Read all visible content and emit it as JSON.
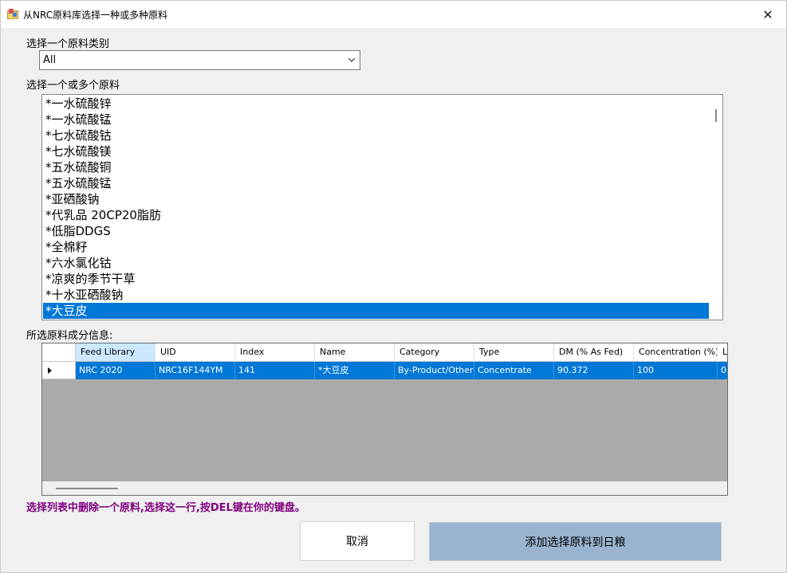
{
  "window": {
    "title": "从NRC原料库选择一种或多种原料",
    "close_glyph": "✕"
  },
  "category": {
    "label": "选择一个原料类别",
    "selected": "All"
  },
  "ingredients": {
    "label": "选择一个或多个原料",
    "items": [
      {
        "label": "*一水硫酸锌",
        "selected": false
      },
      {
        "label": "*一水硫酸锰",
        "selected": false
      },
      {
        "label": "*七水硫酸钴",
        "selected": false
      },
      {
        "label": "*七水硫酸镁",
        "selected": false
      },
      {
        "label": "*五水硫酸铜",
        "selected": false
      },
      {
        "label": "*五水硫酸锰",
        "selected": false
      },
      {
        "label": "*亚硒酸钠",
        "selected": false
      },
      {
        "label": "*代乳品 20CP20脂肪",
        "selected": false
      },
      {
        "label": "*低脂DDGS",
        "selected": false
      },
      {
        "label": "*全棉籽",
        "selected": false
      },
      {
        "label": "*六水氯化钴",
        "selected": false
      },
      {
        "label": "*凉爽的季节干草",
        "selected": false
      },
      {
        "label": "*十水亚硒酸钠",
        "selected": false
      },
      {
        "label": "*大豆皮",
        "selected": true
      }
    ]
  },
  "composition": {
    "label": "所选原料成分信息:",
    "columns": [
      "Feed Library",
      "UID",
      "Index",
      "Name",
      "Category",
      "Type",
      "DM (% As Fed)",
      "Concentration (%)",
      "Lo"
    ],
    "rows": [
      [
        "NRC 2020",
        "NRC16F144YM",
        "141",
        "*大豆皮",
        "By-Product/Other",
        "Concentrate",
        "90.372",
        "100",
        "0"
      ]
    ]
  },
  "hint": "选择列表中删除一个原料,选择这一行,按DEL键在你的键盘。",
  "buttons": {
    "cancel": "取消",
    "add": "添加选择原料到日粮"
  },
  "colors": {
    "selection": "#0078d7",
    "hint": "#800080",
    "add_button": "#99b4d1"
  }
}
